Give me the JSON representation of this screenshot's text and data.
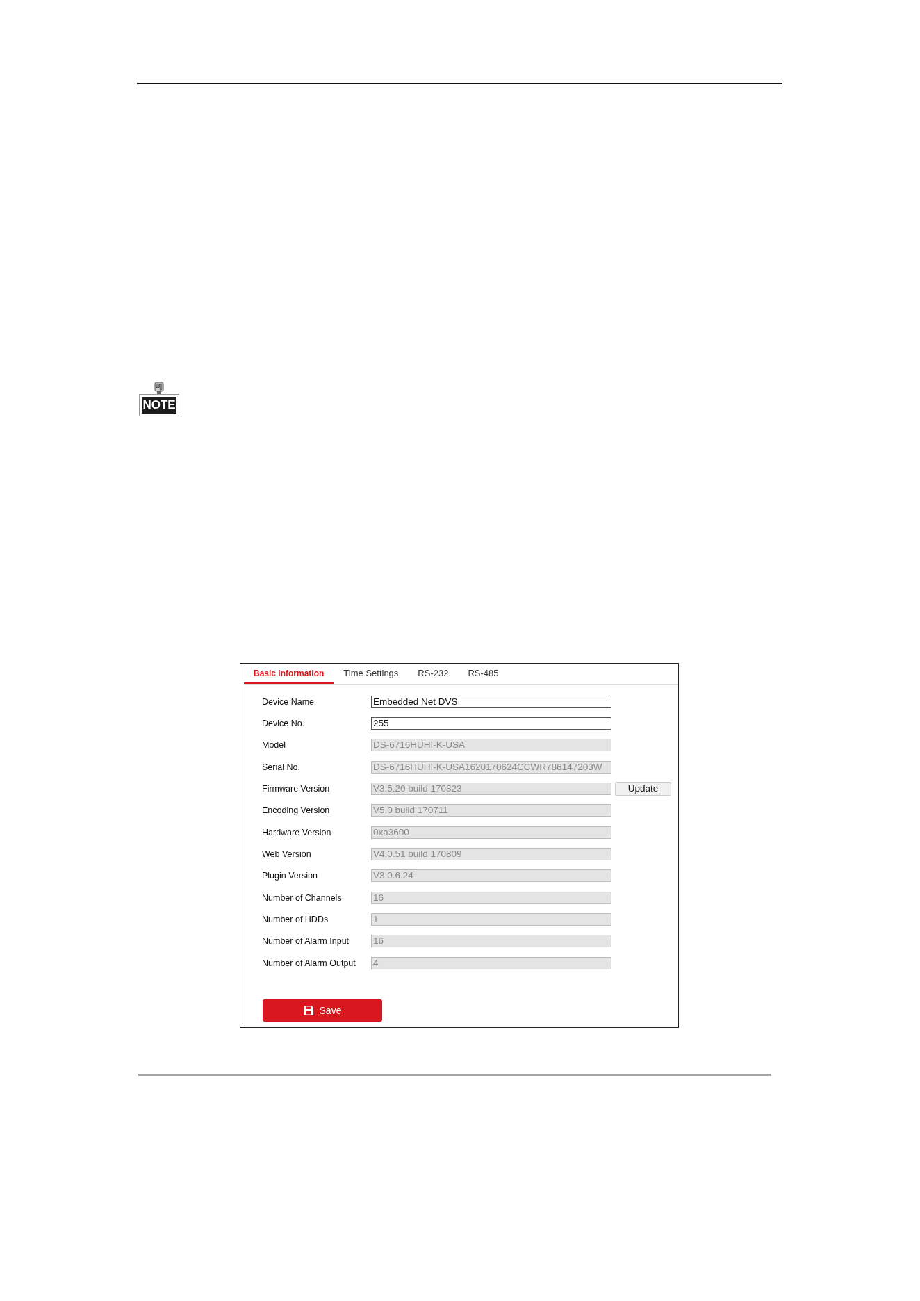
{
  "note": {
    "label": "NOTE"
  },
  "tabs": [
    {
      "label": "Basic Information",
      "selected": true
    },
    {
      "label": "Time Settings",
      "selected": false
    },
    {
      "label": "RS-232",
      "selected": false
    },
    {
      "label": "RS-485",
      "selected": false
    }
  ],
  "fields": [
    {
      "label": "Device Name",
      "value": "Embedded Net DVS",
      "disabled": false
    },
    {
      "label": "Device No.",
      "value": "255",
      "disabled": false
    },
    {
      "label": "Model",
      "value": "DS-6716HUHI-K-USA",
      "disabled": true
    },
    {
      "label": "Serial No.",
      "value": "DS-6716HUHI-K-USA1620170624CCWR786147203W",
      "disabled": true
    },
    {
      "label": "Firmware Version",
      "value": "V3.5.20 build 170823",
      "disabled": true,
      "action": "Update"
    },
    {
      "label": "Encoding Version",
      "value": "V5.0 build 170711",
      "disabled": true
    },
    {
      "label": "Hardware Version",
      "value": "0xa3600",
      "disabled": true
    },
    {
      "label": "Web Version",
      "value": "V4.0.51 build 170809",
      "disabled": true
    },
    {
      "label": "Plugin Version",
      "value": "V3.0.6.24",
      "disabled": true
    },
    {
      "label": "Number of Channels",
      "value": "16",
      "disabled": true
    },
    {
      "label": "Number of HDDs",
      "value": "1",
      "disabled": true
    },
    {
      "label": "Number of Alarm Input",
      "value": "16",
      "disabled": true
    },
    {
      "label": "Number of Alarm Output",
      "value": "4",
      "disabled": true
    }
  ],
  "save_button": {
    "label": "Save"
  }
}
